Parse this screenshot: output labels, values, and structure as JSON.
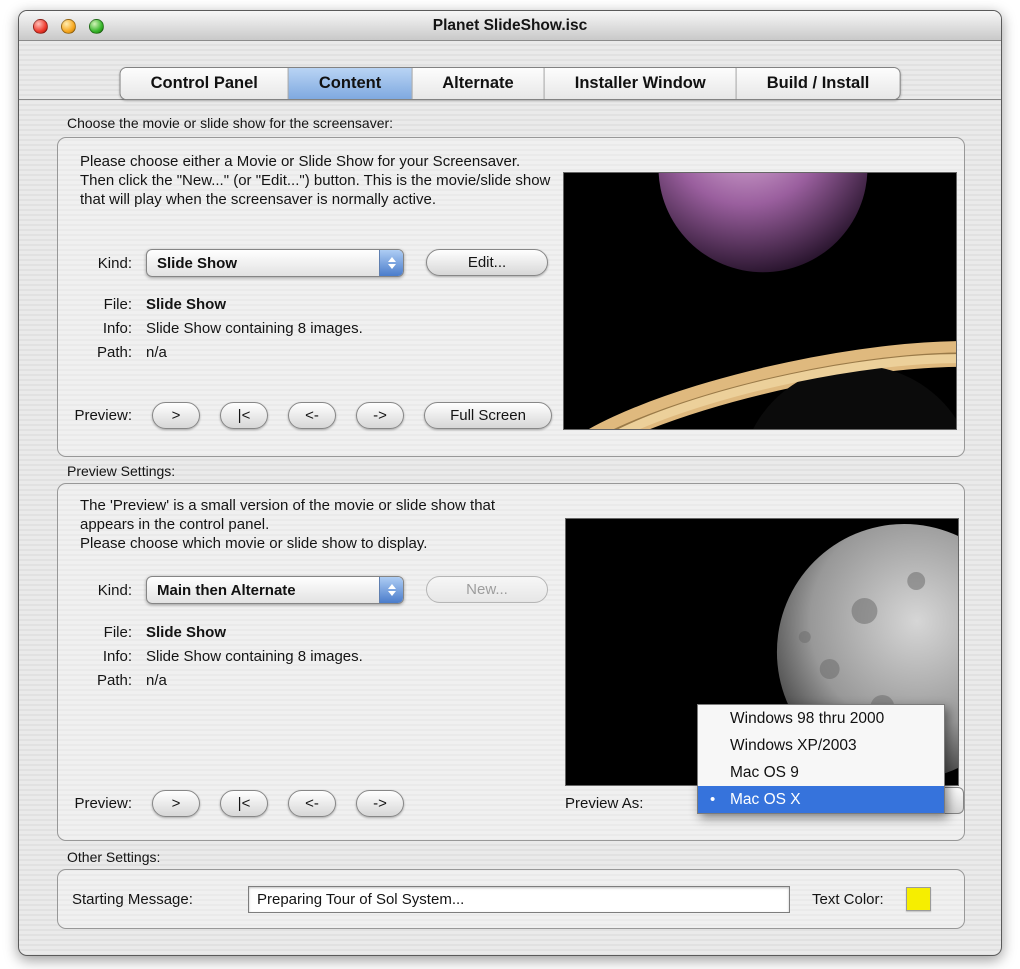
{
  "window": {
    "title": "Planet SlideShow.isc"
  },
  "tabs": [
    {
      "label": "Control Panel"
    },
    {
      "label": "Content"
    },
    {
      "label": "Alternate"
    },
    {
      "label": "Installer Window"
    },
    {
      "label": "Build / Install"
    }
  ],
  "main": {
    "heading": "Choose the movie or slide show for the screensaver:",
    "instructions": "Please choose either a Movie or Slide Show for your Screensaver.  Then click the \"New...\" (or \"Edit...\") button.  This is the movie/slide show that will play when the screensaver is normally active.",
    "kind_label": "Kind:",
    "kind_value": "Slide Show",
    "edit_button": "Edit...",
    "file_label": "File:",
    "file_value": "Slide Show",
    "info_label": "Info:",
    "info_value": "Slide Show containing 8 images.",
    "path_label": "Path:",
    "path_value": "n/a",
    "preview_label": "Preview:",
    "btn_play": ">",
    "btn_start": "|<",
    "btn_back": "<-",
    "btn_forward": "->",
    "btn_fullscreen": "Full Screen"
  },
  "preview_settings": {
    "heading": "Preview Settings:",
    "instructions_1": "The 'Preview' is a small version of the movie or slide show that appears in the control panel.",
    "instructions_2": "Please choose which movie or slide show to display.",
    "kind_label": "Kind:",
    "kind_value": "Main then Alternate",
    "new_button": "New...",
    "file_label": "File:",
    "file_value": "Slide Show",
    "info_label": "Info:",
    "info_value": "Slide Show containing 8 images.",
    "path_label": "Path:",
    "path_value": "n/a",
    "preview_label": "Preview:",
    "btn_play": ">",
    "btn_start": "|<",
    "btn_back": "<-",
    "btn_forward": "->",
    "preview_as_label": "Preview As:",
    "menu": {
      "bullet": "•",
      "selected_index": 3,
      "items": [
        {
          "label": "Windows 98 thru 2000"
        },
        {
          "label": "Windows XP/2003"
        },
        {
          "label": "Mac OS 9"
        },
        {
          "label": "Mac OS X"
        }
      ]
    }
  },
  "other": {
    "heading": "Other Settings:",
    "starting_message_label": "Starting Message:",
    "starting_message_value": "Preparing Tour of Sol System...",
    "text_color_label": "Text Color:",
    "text_color": "#f6ee00"
  },
  "colors": {
    "tab_active": "#8fbce8",
    "menu_highlight": "#3673dc"
  }
}
